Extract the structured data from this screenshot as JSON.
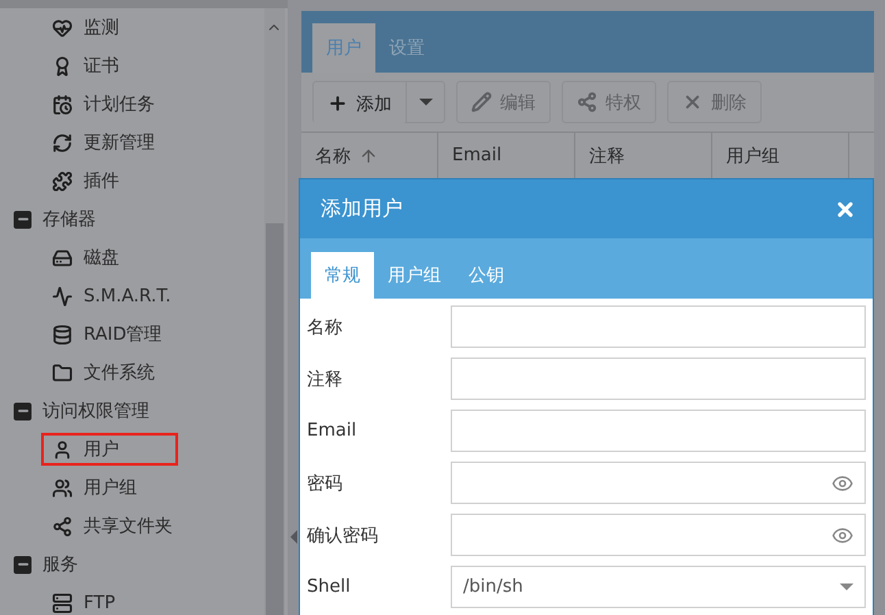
{
  "sidebar": {
    "items": [
      {
        "label": "监测",
        "selected": false
      },
      {
        "label": "证书",
        "selected": false
      },
      {
        "label": "计划任务",
        "selected": false
      },
      {
        "label": "更新管理",
        "selected": false
      },
      {
        "label": "插件",
        "selected": false
      },
      {
        "label": "存储器",
        "expanded": true,
        "children": [
          {
            "label": "磁盘",
            "selected": false
          },
          {
            "label": "S.M.A.R.T.",
            "selected": false
          },
          {
            "label": "RAID管理",
            "selected": false
          },
          {
            "label": "文件系统",
            "selected": false
          }
        ]
      },
      {
        "label": "访问权限管理",
        "expanded": true,
        "children": [
          {
            "label": "用户",
            "selected": true
          },
          {
            "label": "用户组",
            "selected": false
          },
          {
            "label": "共享文件夹",
            "selected": false
          }
        ]
      },
      {
        "label": "服务",
        "expanded": true,
        "children": [
          {
            "label": "FTP",
            "selected": false
          }
        ]
      }
    ]
  },
  "tabs": [
    {
      "label": "用户",
      "selected": true
    },
    {
      "label": "设置",
      "selected": false
    }
  ],
  "toolbar": [
    {
      "label": "添加",
      "disabled": false,
      "split": true
    },
    {
      "label": "编辑",
      "disabled": true,
      "split": false
    },
    {
      "label": "特权",
      "disabled": true,
      "split": false
    },
    {
      "label": "删除",
      "disabled": true,
      "split": false
    }
  ],
  "table": {
    "columns": [
      {
        "label": "名称",
        "sorted": true
      },
      {
        "label": "Email",
        "sorted": false
      },
      {
        "label": "注释",
        "sorted": false
      },
      {
        "label": "用户组",
        "sorted": false
      }
    ]
  },
  "dialog": {
    "title": "添加用户",
    "tabs": [
      {
        "label": "常规",
        "selected": true
      },
      {
        "label": "用户组",
        "selected": false
      },
      {
        "label": "公钥",
        "selected": false
      }
    ],
    "fields": [
      {
        "label": "名称",
        "kind": "text"
      },
      {
        "label": "注释",
        "kind": "text"
      },
      {
        "label": "Email",
        "kind": "text"
      },
      {
        "label": "密码",
        "kind": "password"
      },
      {
        "label": "确认密码",
        "kind": "password"
      },
      {
        "label": "Shell",
        "kind": "select",
        "value": "/bin/sh"
      }
    ]
  }
}
